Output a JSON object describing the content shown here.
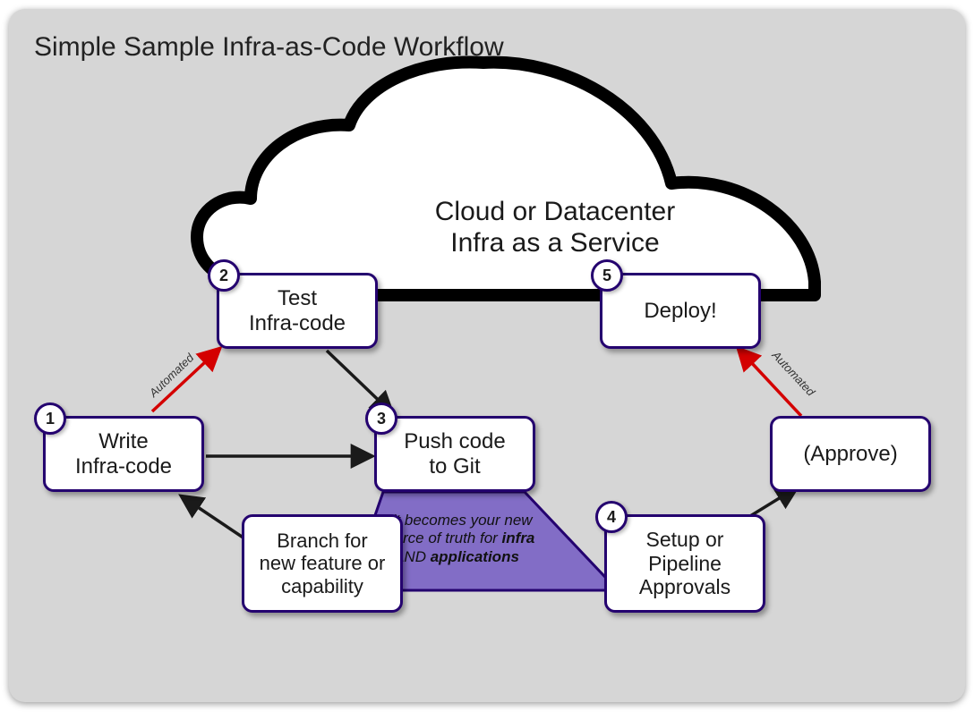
{
  "title": "Simple Sample Infra-as-Code Workflow",
  "cloud_label_line1": "Cloud or Datacenter",
  "cloud_label_line2": "Infra as a Service",
  "nodes": {
    "write": {
      "num": "1",
      "label": "Write\nInfra-code"
    },
    "test": {
      "num": "2",
      "label": "Test\nInfra-code"
    },
    "push": {
      "num": "3",
      "label": "Push code\nto Git"
    },
    "setup": {
      "num": "4",
      "label": "Setup or\nPipeline\nApprovals"
    },
    "deploy": {
      "num": "5",
      "label": "Deploy!"
    },
    "approve": {
      "label": "(Approve)"
    },
    "branch": {
      "label": "Branch for\nnew feature or\ncapability"
    }
  },
  "edge_labels": {
    "auto_left": "Automated",
    "auto_right": "Automated"
  },
  "git_note": {
    "pre": "Git becomes your new source of truth for ",
    "b1": "infra",
    "mid": " AND ",
    "b2": "applications"
  },
  "colors": {
    "border": "#24016f",
    "fill_purple": "#826dc6",
    "arrow_black": "#1a1a1a",
    "arrow_red": "#d40000"
  }
}
